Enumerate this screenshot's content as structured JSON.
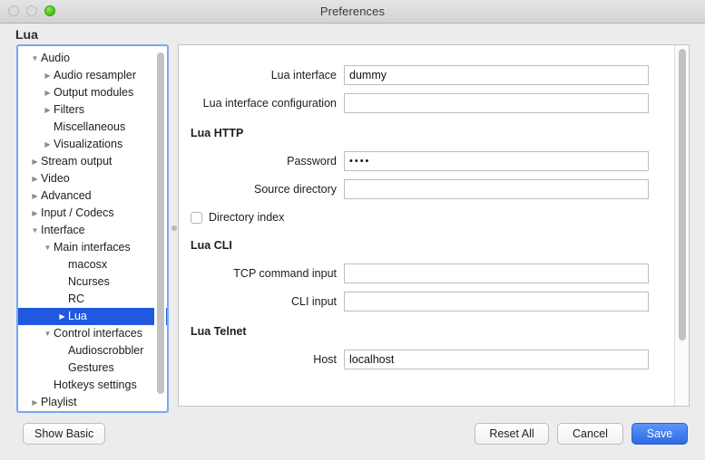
{
  "window": {
    "title": "Preferences",
    "traffic_lights": [
      "close-button",
      "minimize-button",
      "zoom-button"
    ]
  },
  "page_heading": "Lua",
  "sidebar": {
    "items": [
      {
        "label": "Audio",
        "level": 0,
        "twisty": "down",
        "selected": false
      },
      {
        "label": "Audio resampler",
        "level": 1,
        "twisty": "right",
        "selected": false
      },
      {
        "label": "Output modules",
        "level": 1,
        "twisty": "right",
        "selected": false
      },
      {
        "label": "Filters",
        "level": 1,
        "twisty": "right",
        "selected": false
      },
      {
        "label": "Miscellaneous",
        "level": 1,
        "twisty": "none",
        "selected": false
      },
      {
        "label": "Visualizations",
        "level": 1,
        "twisty": "right",
        "selected": false
      },
      {
        "label": "Stream output",
        "level": 0,
        "twisty": "right",
        "selected": false
      },
      {
        "label": "Video",
        "level": 0,
        "twisty": "right",
        "selected": false
      },
      {
        "label": "Advanced",
        "level": 0,
        "twisty": "right",
        "selected": false
      },
      {
        "label": "Input / Codecs",
        "level": 0,
        "twisty": "right",
        "selected": false
      },
      {
        "label": "Interface",
        "level": 0,
        "twisty": "down",
        "selected": false
      },
      {
        "label": "Main interfaces",
        "level": 1,
        "twisty": "down",
        "selected": false
      },
      {
        "label": "macosx",
        "level": 2,
        "twisty": "none",
        "selected": false
      },
      {
        "label": "Ncurses",
        "level": 2,
        "twisty": "none",
        "selected": false
      },
      {
        "label": "RC",
        "level": 2,
        "twisty": "none",
        "selected": false
      },
      {
        "label": "Lua",
        "level": 2,
        "twisty": "none",
        "selected": true
      },
      {
        "label": "Control interfaces",
        "level": 1,
        "twisty": "down",
        "selected": false
      },
      {
        "label": "Audioscrobbler",
        "level": 2,
        "twisty": "none",
        "selected": false
      },
      {
        "label": "Gestures",
        "level": 2,
        "twisty": "none",
        "selected": false
      },
      {
        "label": "Hotkeys settings",
        "level": 1,
        "twisty": "none",
        "selected": false
      },
      {
        "label": "Playlist",
        "level": 0,
        "twisty": "right",
        "selected": false
      }
    ]
  },
  "form": {
    "fields": {
      "lua_interface": {
        "label": "Lua interface",
        "value": "dummy"
      },
      "lua_interface_config": {
        "label": "Lua interface configuration",
        "value": ""
      },
      "password": {
        "label": "Password",
        "value": "••••"
      },
      "source_directory": {
        "label": "Source directory",
        "value": ""
      },
      "tcp_command_input": {
        "label": "TCP command input",
        "value": ""
      },
      "cli_input": {
        "label": "CLI input",
        "value": ""
      },
      "host": {
        "label": "Host",
        "value": "localhost"
      }
    },
    "groups": {
      "http": "Lua HTTP",
      "cli": "Lua CLI",
      "telnet": "Lua Telnet"
    },
    "directory_index": {
      "label": "Directory index",
      "checked": false
    }
  },
  "footer": {
    "show_basic": "Show Basic",
    "reset_all": "Reset All",
    "cancel": "Cancel",
    "save": "Save"
  },
  "colors": {
    "selection_blue": "#2158e0",
    "primary_button": "#2f6ae6",
    "focus_ring": "#7aa7f0",
    "zoom_light_green": "#46c018"
  }
}
